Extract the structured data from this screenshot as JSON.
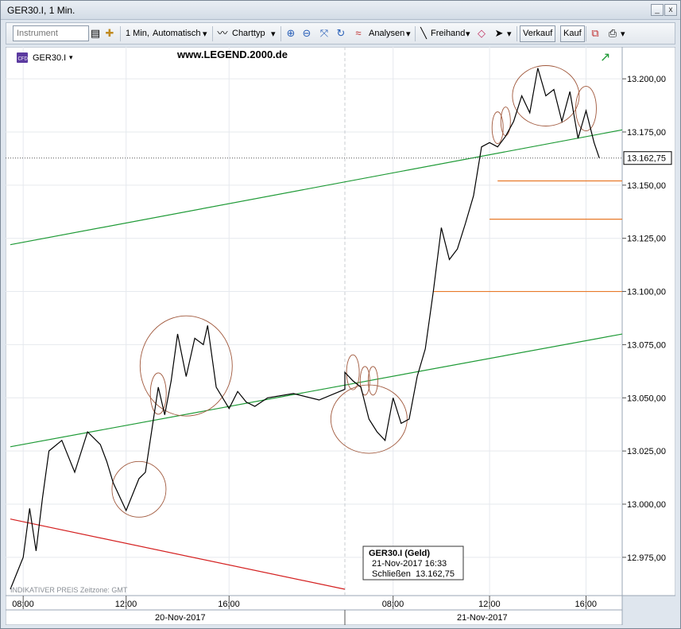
{
  "window": {
    "title": "GER30.I, 1 Min.",
    "minimize": "_",
    "close": "x"
  },
  "toolbar": {
    "instrument_placeholder": "Instrument",
    "interval_label": "1 Min,",
    "scale_label": "Automatisch",
    "charttyp_label": "Charttyp",
    "analysen_label": "Analysen",
    "freihand_label": "Freihand",
    "verkauf_label": "Verkauf",
    "kauf_label": "Kauf"
  },
  "chart": {
    "instrument_label": "GER30.I",
    "instrument_badge": "CFD",
    "watermark": "www.LEGEND.2000.de",
    "footer_note": "INDIKATIVER PREIS   Zeitzone: GMT",
    "current_price_label": "13.162,75",
    "tooltip": {
      "title": "GER30.I (Geld)",
      "datetime": "21-Nov-2017 16:33",
      "close_label": "Schließen",
      "close_value": "13.162,75"
    },
    "colors": {
      "price_line": "#000000",
      "trend_green": "#1e9a36",
      "trend_red": "#d42020",
      "support_orange": "#e87a2a",
      "circle": "#a0583c"
    }
  },
  "chart_data": {
    "type": "line",
    "title": "GER30.I, 1 Min.",
    "xlabel": "",
    "ylabel": "",
    "ylim": [
      12957,
      13215
    ],
    "y_tick_labels": [
      "12.975,00",
      "13.000,00",
      "13.025,00",
      "13.050,00",
      "13.075,00",
      "13.100,00",
      "13.125,00",
      "13.150,00",
      "13.175,00",
      "13.200,00"
    ],
    "y_ticks": [
      12975,
      13000,
      13025,
      13050,
      13075,
      13100,
      13125,
      13150,
      13175,
      13200
    ],
    "x_tick_labels": [
      "08:00",
      "12:00",
      "16:00",
      "08:00",
      "12:00",
      "16:00"
    ],
    "date_labels": [
      "20-Nov-2017",
      "21-Nov-2017"
    ],
    "last_price": 13162.75,
    "series": [
      {
        "x": [
          "20-Nov 07:30",
          "20-Nov 08:00",
          "20-Nov 08:15",
          "20-Nov 08:30",
          "20-Nov 08:45",
          "20-Nov 09:00",
          "20-Nov 09:30",
          "20-Nov 10:00",
          "20-Nov 10:30",
          "20-Nov 11:00",
          "20-Nov 11:15",
          "20-Nov 11:30",
          "20-Nov 12:00",
          "20-Nov 12:30",
          "20-Nov 12:45",
          "20-Nov 13:00",
          "20-Nov 13:15",
          "20-Nov 13:30",
          "20-Nov 13:45",
          "20-Nov 14:00",
          "20-Nov 14:20",
          "20-Nov 14:40",
          "20-Nov 15:00",
          "20-Nov 15:10",
          "20-Nov 15:30",
          "20-Nov 16:00",
          "20-Nov 16:20",
          "20-Nov 16:40",
          "20-Nov 17:00",
          "20-Nov 17:30",
          "20-Nov 18:30",
          "20-Nov 19:30",
          "20-Nov 20:30",
          "21-Nov 06:00",
          "21-Nov 06:20",
          "21-Nov 06:40",
          "21-Nov 07:00",
          "21-Nov 07:20",
          "21-Nov 07:40",
          "21-Nov 08:00",
          "21-Nov 08:20",
          "21-Nov 08:40",
          "21-Nov 09:00",
          "21-Nov 09:20",
          "21-Nov 09:40",
          "21-Nov 10:00",
          "21-Nov 10:20",
          "21-Nov 10:40",
          "21-Nov 11:00",
          "21-Nov 11:20",
          "21-Nov 11:40",
          "21-Nov 12:00",
          "21-Nov 12:20",
          "21-Nov 12:40",
          "21-Nov 13:00",
          "21-Nov 13:20",
          "21-Nov 13:40",
          "21-Nov 14:00",
          "21-Nov 14:20",
          "21-Nov 14:40",
          "21-Nov 15:00",
          "21-Nov 15:20",
          "21-Nov 15:40",
          "21-Nov 16:00",
          "21-Nov 16:20",
          "21-Nov 16:33"
        ],
        "values": [
          12960,
          12975,
          12998,
          12978,
          13003,
          13025,
          13030,
          13015,
          13034,
          13028,
          13020,
          13010,
          12997,
          13012,
          13015,
          13035,
          13055,
          13042,
          13058,
          13080,
          13060,
          13078,
          13075,
          13084,
          13055,
          13045,
          13053,
          13048,
          13046,
          13050,
          13052,
          13049,
          13054,
          13062,
          13058,
          13055,
          13040,
          13034,
          13030,
          13050,
          13038,
          13040,
          13060,
          13073,
          13100,
          13130,
          13115,
          13120,
          13132,
          13145,
          13168,
          13170,
          13168,
          13173,
          13180,
          13192,
          13184,
          13205,
          13192,
          13195,
          13180,
          13194,
          13172,
          13185,
          13170,
          13162.75
        ]
      },
      {
        "name": "",
        "values": []
      }
    ],
    "trend_lines": [
      {
        "from": [
          "20-Nov 07:30",
          13122
        ],
        "to": [
          "21-Nov 17:30",
          13176
        ]
      },
      {
        "from": [
          "20-Nov 07:30",
          13027
        ],
        "to": [
          "21-Nov 17:30",
          13080
        ]
      },
      {
        "from": [
          "20-Nov 07:30",
          12993
        ],
        "to": [
          "20-Nov 20:30",
          12960
        ]
      }
    ],
    "horizontal_levels": [
      13152,
      13134,
      13100
    ]
  }
}
